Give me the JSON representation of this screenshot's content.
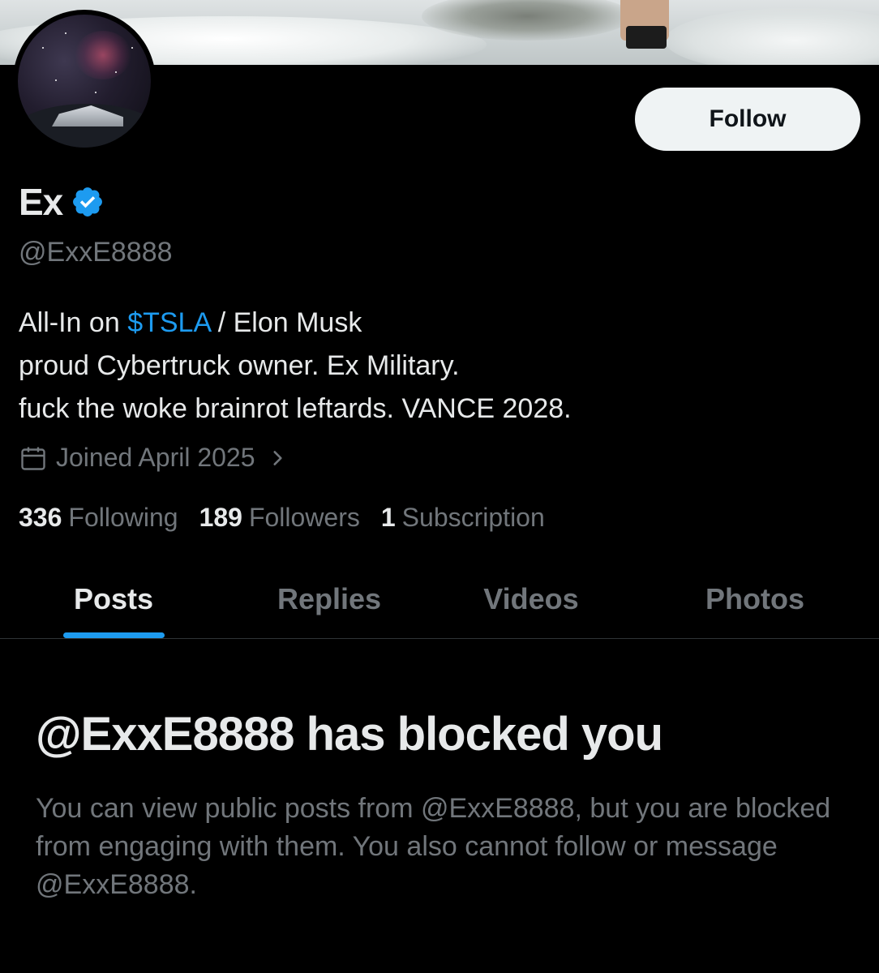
{
  "colors": {
    "background": "#000000",
    "accent": "#1d9bf0",
    "primary_text": "#e7e9ea",
    "secondary_text": "#71767b",
    "follow_bg": "#eff3f4"
  },
  "profile": {
    "display_name": "Ex",
    "handle": "@ExxE8888",
    "verified_icon": "verified-badge-icon",
    "bio": {
      "line1_prefix": "All-In on ",
      "line1_cashtag": "$TSLA",
      "line1_suffix": " / Elon Musk",
      "line2": "proud Cybertruck owner. Ex Military.",
      "line3": "fuck the woke brainrot leftards. VANCE 2028."
    },
    "joined": "Joined April 2025",
    "follow_label": "Follow"
  },
  "stats": {
    "following_count": "336",
    "following_label": "Following",
    "followers_count": "189",
    "followers_label": "Followers",
    "subscription_count": "1",
    "subscription_label": "Subscription"
  },
  "tabs": [
    {
      "label": "Posts",
      "active": true
    },
    {
      "label": "Replies",
      "active": false
    },
    {
      "label": "Videos",
      "active": false
    },
    {
      "label": "Photos",
      "active": false
    }
  ],
  "blocked": {
    "title": "@ExxE8888 has blocked you",
    "description": "You can view public posts from @ExxE8888, but you are blocked from engaging with them. You also cannot follow or message @ExxE8888."
  }
}
